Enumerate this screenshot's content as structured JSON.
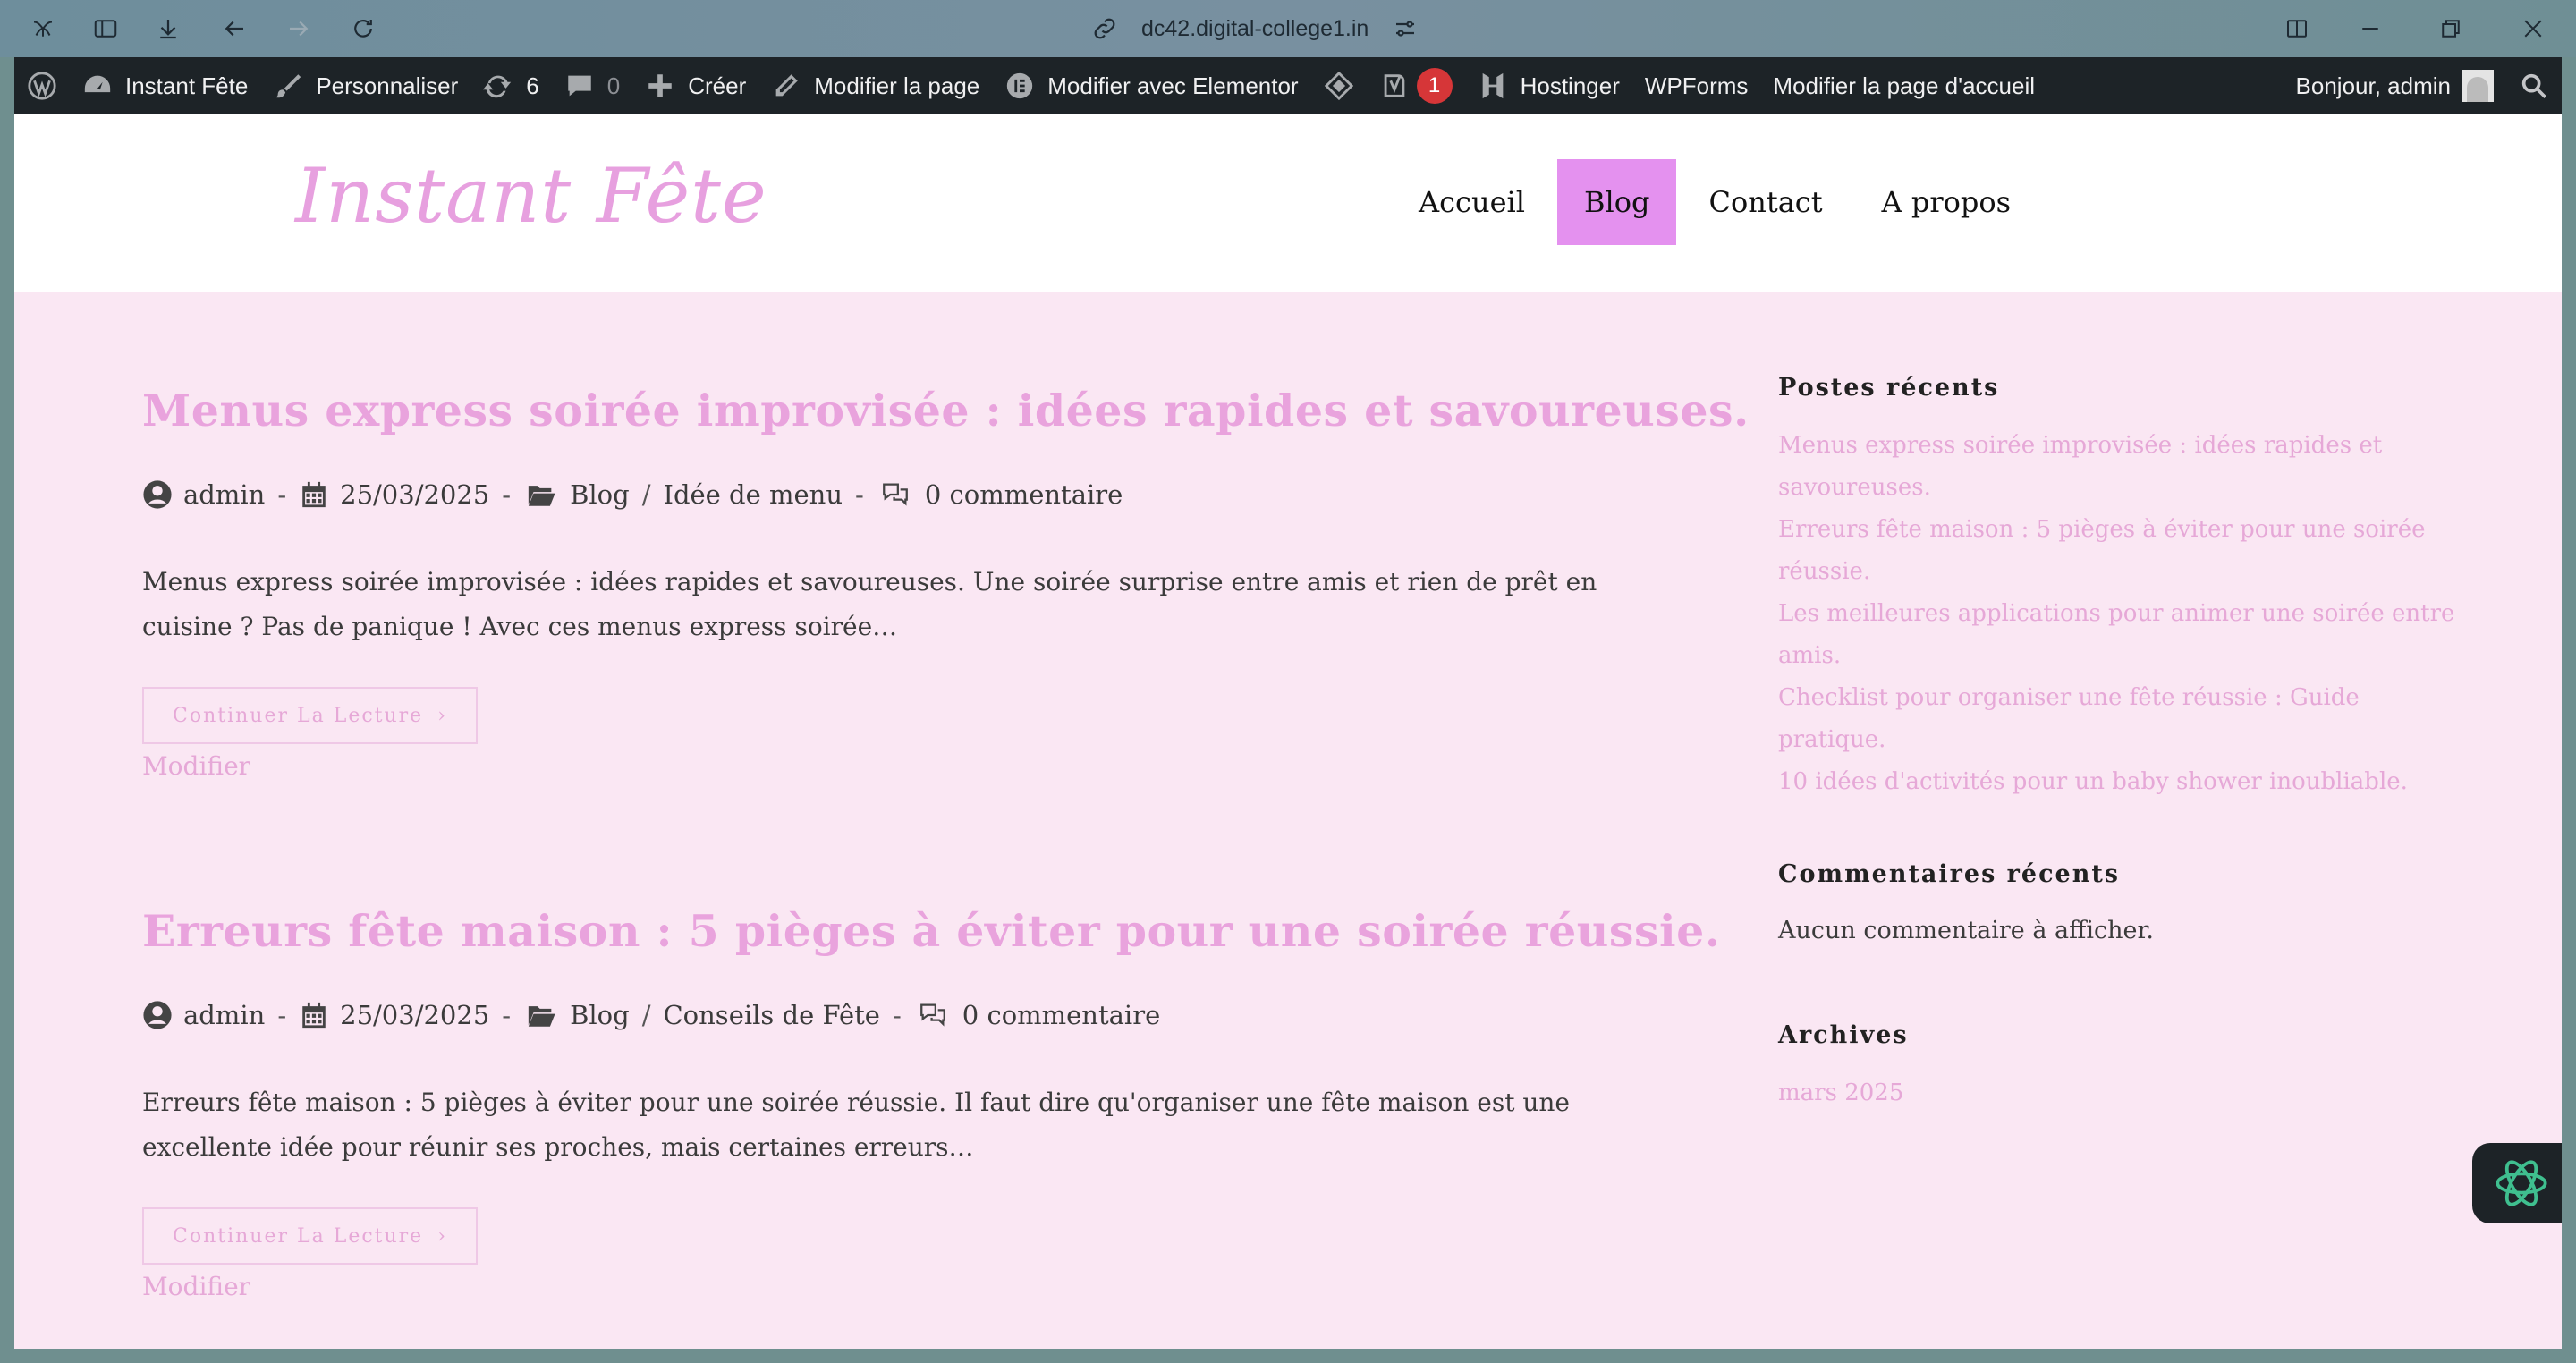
{
  "browser": {
    "url": "dc42.digital-college1.in"
  },
  "admin_bar": {
    "site_name": "Instant Fête",
    "customize": "Personnaliser",
    "updates_count": "6",
    "comments_count": "0",
    "new": "Créer",
    "edit_page": "Modifier la page",
    "elementor": "Modifier avec Elementor",
    "yoast_badge": "1",
    "hostinger": "Hostinger",
    "wpforms": "WPForms",
    "edit_home": "Modifier la page d'accueil",
    "greeting": "Bonjour, admin"
  },
  "site": {
    "title": "Instant Fête",
    "nav": [
      {
        "label": "Accueil"
      },
      {
        "label": "Blog",
        "active": true
      },
      {
        "label": "Contact"
      },
      {
        "label": "A propos"
      }
    ]
  },
  "posts": [
    {
      "title": "Menus express soirée improvisée : idées rapides et savoureuses.",
      "author": "admin",
      "date": "25/03/2025",
      "category1": "Blog",
      "category_sep": "/",
      "category2": "Idée de menu",
      "comments": "0 commentaire",
      "excerpt": "Menus express soirée improvisée : idées rapides et savoureuses. Une soirée surprise entre amis et rien de prêt en cuisine ? Pas de panique ! Avec ces menus express soirée…",
      "read_more": "Continuer La Lecture",
      "edit": "Modifier"
    },
    {
      "title": "Erreurs fête maison : 5 pièges à éviter pour une soirée réussie.",
      "author": "admin",
      "date": "25/03/2025",
      "category1": "Blog",
      "category_sep": "/",
      "category2": "Conseils de Fête",
      "comments": "0 commentaire",
      "excerpt": "Erreurs fête maison : 5 pièges à éviter pour une soirée réussie. Il faut dire qu'organiser une fête maison est une excellente idée pour réunir ses proches, mais certaines erreurs…",
      "read_more": "Continuer La Lecture",
      "edit": "Modifier"
    }
  ],
  "meta_separator": "-",
  "sidebar": {
    "recent_posts_title": "Postes récents",
    "recent_posts": [
      "Menus express soirée improvisée : idées rapides et",
      "savoureuses.",
      "Erreurs fête maison : 5 pièges à éviter pour une soirée réussie.",
      "Les meilleures applications pour animer une soirée entre",
      "amis.",
      "Checklist pour organiser une fête réussie : Guide pratique.",
      "10 idées d'activités pour un baby shower inoubliable."
    ],
    "recent_comments_title": "Commentaires récents",
    "recent_comments_text": "Aucun commentaire à afficher.",
    "archives_title": "Archives",
    "archive_item": "mars 2025"
  },
  "colors": {
    "accent_pink": "#e9a3dd",
    "nav_active": "#e491ef",
    "page_bg": "#fae7f3",
    "admin_bar": "#1d2327"
  }
}
